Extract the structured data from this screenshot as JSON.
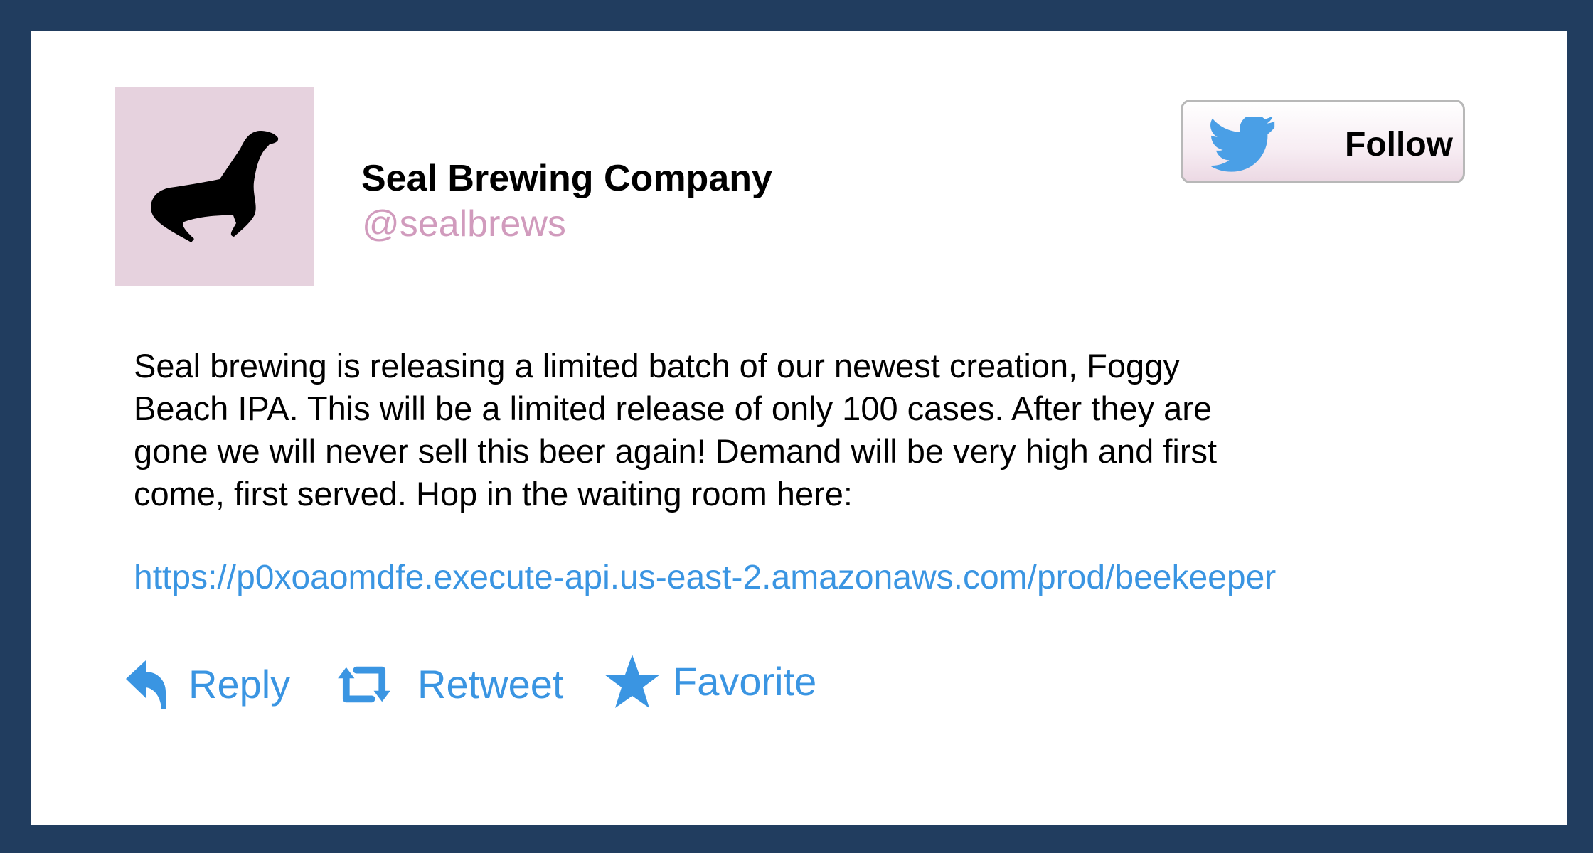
{
  "profile": {
    "avatar_icon": "seal-icon",
    "display_name": "Seal Brewing Company",
    "handle": "@sealbrews"
  },
  "follow_button": {
    "icon": "twitter-bird-icon",
    "label": "Follow"
  },
  "tweet": {
    "text_lines": [
      "Seal brewing is releasing a limited batch of our newest creation, Foggy",
      "Beach IPA. This will be a limited release of only 100 cases. After they are",
      "gone we will never sell this beer again! Demand will be very high and first",
      "come, first served. Hop in the waiting room here:"
    ],
    "link": "https://p0xoaomdfe.execute-api.us-east-2.amazonaws.com/prod/beekeeper"
  },
  "actions": {
    "reply": {
      "icon": "reply-icon",
      "label": "Reply"
    },
    "retweet": {
      "icon": "retweet-icon",
      "label": "Retweet"
    },
    "favorite": {
      "icon": "star-icon",
      "label": "Favorite"
    }
  },
  "colors": {
    "frame_border": "#213d5f",
    "avatar_background": "#e6d2de",
    "handle": "#d19bbd",
    "link_and_actions": "#3a95e2",
    "twitter_bird": "#4a9fe6"
  }
}
